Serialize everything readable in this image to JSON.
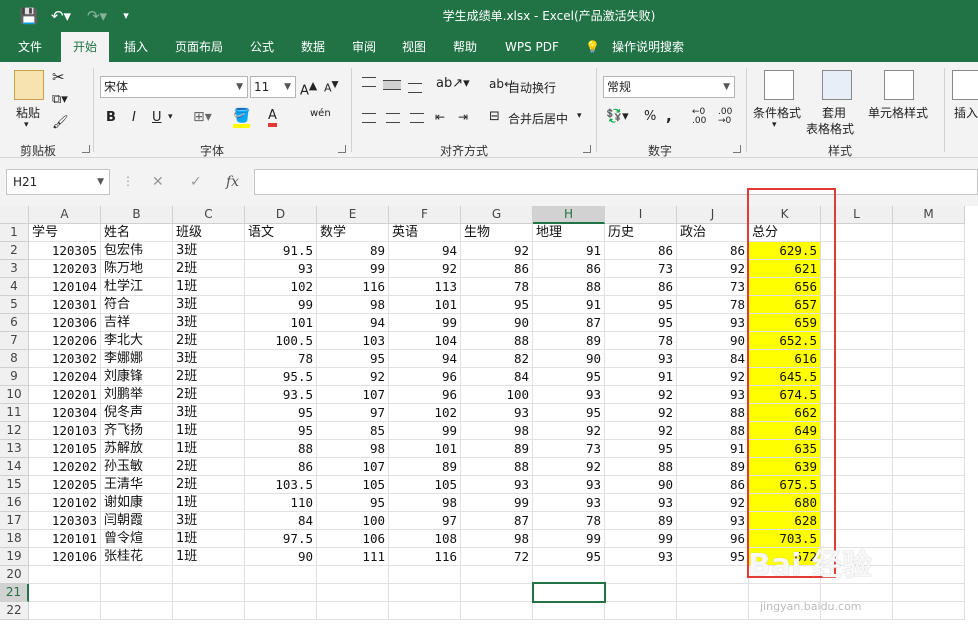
{
  "title": "学生成绩单.xlsx  -  Excel(产品激活失败)",
  "menu": [
    "文件",
    "开始",
    "插入",
    "页面布局",
    "公式",
    "数据",
    "审阅",
    "视图",
    "帮助",
    "WPS PDF",
    "操作说明搜索"
  ],
  "ribbon": {
    "clipboard": {
      "paste": "粘贴",
      "group": "剪贴板"
    },
    "font": {
      "name": "宋体",
      "size": "11",
      "bold": "B",
      "italic": "I",
      "underline": "U",
      "font_color_letter": "A",
      "wen": "wén",
      "group": "字体"
    },
    "align": {
      "wrap": "自动换行",
      "merge": "合并后居中",
      "group": "对齐方式"
    },
    "number": {
      "format": "常规",
      "percent": "%",
      "comma": ",",
      "group": "数字"
    },
    "styles": {
      "cond": "条件格式",
      "table1": "套用",
      "table2": "表格格式",
      "cell": "单元格样式",
      "group": "样式"
    },
    "insert": "插入"
  },
  "formula": {
    "namebox": "H21",
    "fx": "fx",
    "cancel": "✕",
    "enter": "✓"
  },
  "columns": [
    "A",
    "B",
    "C",
    "D",
    "E",
    "F",
    "G",
    "H",
    "I",
    "J",
    "K",
    "L",
    "M"
  ],
  "headers": [
    "学号",
    "姓名",
    "班级",
    "语文",
    "数学",
    "英语",
    "生物",
    "地理",
    "历史",
    "政治",
    "总分"
  ],
  "rows": [
    [
      "120305",
      "包宏伟",
      "3班",
      "91.5",
      "89",
      "94",
      "92",
      "91",
      "86",
      "86",
      "629.5"
    ],
    [
      "120203",
      "陈万地",
      "2班",
      "93",
      "99",
      "92",
      "86",
      "86",
      "73",
      "92",
      "621"
    ],
    [
      "120104",
      "杜学江",
      "1班",
      "102",
      "116",
      "113",
      "78",
      "88",
      "86",
      "73",
      "656"
    ],
    [
      "120301",
      "符合",
      "3班",
      "99",
      "98",
      "101",
      "95",
      "91",
      "95",
      "78",
      "657"
    ],
    [
      "120306",
      "吉祥",
      "3班",
      "101",
      "94",
      "99",
      "90",
      "87",
      "95",
      "93",
      "659"
    ],
    [
      "120206",
      "李北大",
      "2班",
      "100.5",
      "103",
      "104",
      "88",
      "89",
      "78",
      "90",
      "652.5"
    ],
    [
      "120302",
      "李娜娜",
      "3班",
      "78",
      "95",
      "94",
      "82",
      "90",
      "93",
      "84",
      "616"
    ],
    [
      "120204",
      "刘康锋",
      "2班",
      "95.5",
      "92",
      "96",
      "84",
      "95",
      "91",
      "92",
      "645.5"
    ],
    [
      "120201",
      "刘鹏举",
      "2班",
      "93.5",
      "107",
      "96",
      "100",
      "93",
      "92",
      "93",
      "674.5"
    ],
    [
      "120304",
      "倪冬声",
      "3班",
      "95",
      "97",
      "102",
      "93",
      "95",
      "92",
      "88",
      "662"
    ],
    [
      "120103",
      "齐飞扬",
      "1班",
      "95",
      "85",
      "99",
      "98",
      "92",
      "92",
      "88",
      "649"
    ],
    [
      "120105",
      "苏解放",
      "1班",
      "88",
      "98",
      "101",
      "89",
      "73",
      "95",
      "91",
      "635"
    ],
    [
      "120202",
      "孙玉敏",
      "2班",
      "86",
      "107",
      "89",
      "88",
      "92",
      "88",
      "89",
      "639"
    ],
    [
      "120205",
      "王清华",
      "2班",
      "103.5",
      "105",
      "105",
      "93",
      "93",
      "90",
      "86",
      "675.5"
    ],
    [
      "120102",
      "谢如康",
      "1班",
      "110",
      "95",
      "98",
      "99",
      "93",
      "93",
      "92",
      "680"
    ],
    [
      "120303",
      "闫朝霞",
      "3班",
      "84",
      "100",
      "97",
      "87",
      "78",
      "89",
      "93",
      "628"
    ],
    [
      "120101",
      "曾令煊",
      "1班",
      "97.5",
      "106",
      "108",
      "98",
      "99",
      "99",
      "96",
      "703.5"
    ],
    [
      "120106",
      "张桂花",
      "1班",
      "90",
      "111",
      "116",
      "72",
      "95",
      "93",
      "95",
      "672"
    ]
  ],
  "row_numbers": [
    "1",
    "2",
    "3",
    "4",
    "5",
    "6",
    "7",
    "8",
    "9",
    "10",
    "11",
    "12",
    "13",
    "14",
    "15",
    "16",
    "17",
    "18",
    "19",
    "20",
    "21",
    "22"
  ],
  "watermark": {
    "brand": "Bai 经验",
    "url": "jingyan.baidu.com"
  },
  "colors": {
    "excel_green": "#217346",
    "highlight": "#ffff00",
    "annotation": "#e53935"
  }
}
